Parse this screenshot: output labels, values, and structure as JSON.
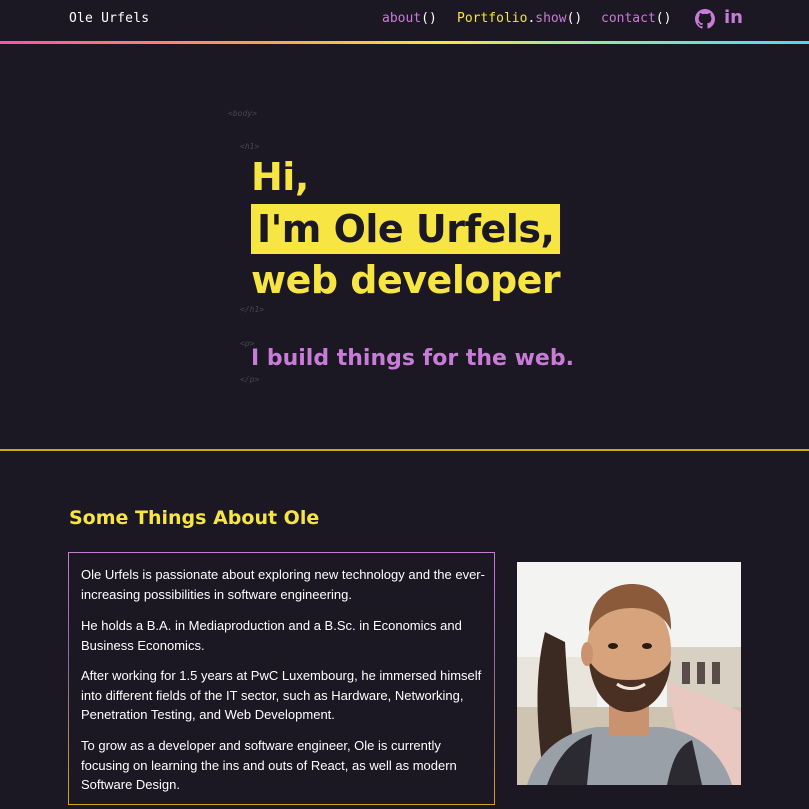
{
  "nav": {
    "brand": "Ole Urfels",
    "about_word": "about",
    "about_paren": "()",
    "portfolio_word": "Portfolio",
    "portfolio_dot": ".",
    "portfolio_method": "show",
    "portfolio_paren": "()",
    "contact_word": "contact",
    "contact_paren": "()",
    "github_icon": "github-icon",
    "linkedin_label": "in"
  },
  "hero": {
    "tag_body": "<body>",
    "tag_h1_open": "<h1>",
    "tag_h1_close": "</h1>",
    "tag_p_open": "<p>",
    "tag_p_close": "</p>",
    "line1": "Hi,",
    "line2": "I'm Ole Urfels,",
    "line3": "web developer",
    "tagline": "I build things for the web."
  },
  "about": {
    "title": "Some Things About Ole",
    "paragraphs": [
      "Ole Urfels is passionate about exploring new technology and the ever-increasing possibilities in software engineering.",
      "He holds a B.A. in Mediaproduction and a B.Sc. in Economics and Business Economics.",
      "After working for 1.5 years at PwC Luxembourg, he immersed himself into different fields of the IT sector, such as Hardware, Networking, Penetration Testing, and Web Development.",
      "To grow as a developer and software engineer, Ole is currently focusing on learning the ins and outs of React, as well as modern Software Design."
    ]
  },
  "colors": {
    "background": "#1b1723",
    "yellow": "#f7e543",
    "purple": "#c97bd8"
  }
}
